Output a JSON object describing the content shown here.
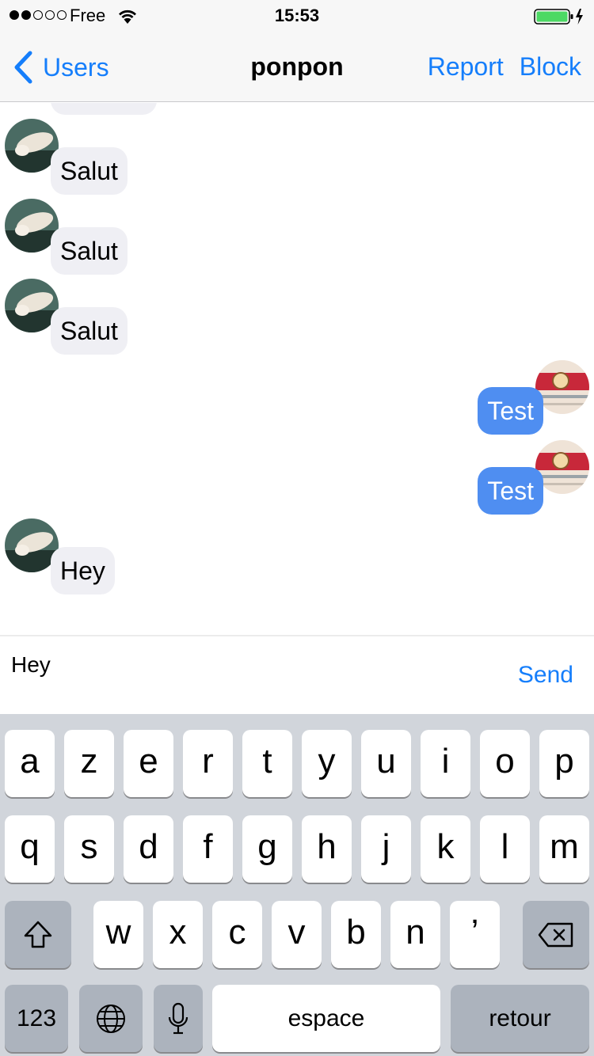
{
  "status_bar": {
    "carrier": "Free",
    "time": "15:53",
    "colors": {
      "battery": "#4cd964"
    }
  },
  "nav": {
    "back_label": "Users",
    "title": "ponpon",
    "report_label": "Report",
    "block_label": "Block",
    "colors": {
      "accent": "#157efb"
    }
  },
  "messages": [
    {
      "text": "Salut",
      "direction": "incoming"
    },
    {
      "text": "Salut",
      "direction": "incoming"
    },
    {
      "text": "Salut",
      "direction": "incoming"
    },
    {
      "text": "Test",
      "direction": "outgoing"
    },
    {
      "text": "Test",
      "direction": "outgoing"
    },
    {
      "text": "Hey",
      "direction": "incoming"
    }
  ],
  "input": {
    "value": "Hey",
    "send_label": "Send"
  },
  "keyboard": {
    "row1": [
      "a",
      "z",
      "e",
      "r",
      "t",
      "y",
      "u",
      "i",
      "o",
      "p"
    ],
    "row2": [
      "q",
      "s",
      "d",
      "f",
      "g",
      "h",
      "j",
      "k",
      "l",
      "m"
    ],
    "row3": [
      "w",
      "x",
      "c",
      "v",
      "b",
      "n",
      "’"
    ],
    "numbers_label": "123",
    "space_label": "espace",
    "return_label": "retour",
    "icons": [
      "shift-icon",
      "backspace-icon",
      "globe-icon",
      "microphone-icon"
    ]
  }
}
